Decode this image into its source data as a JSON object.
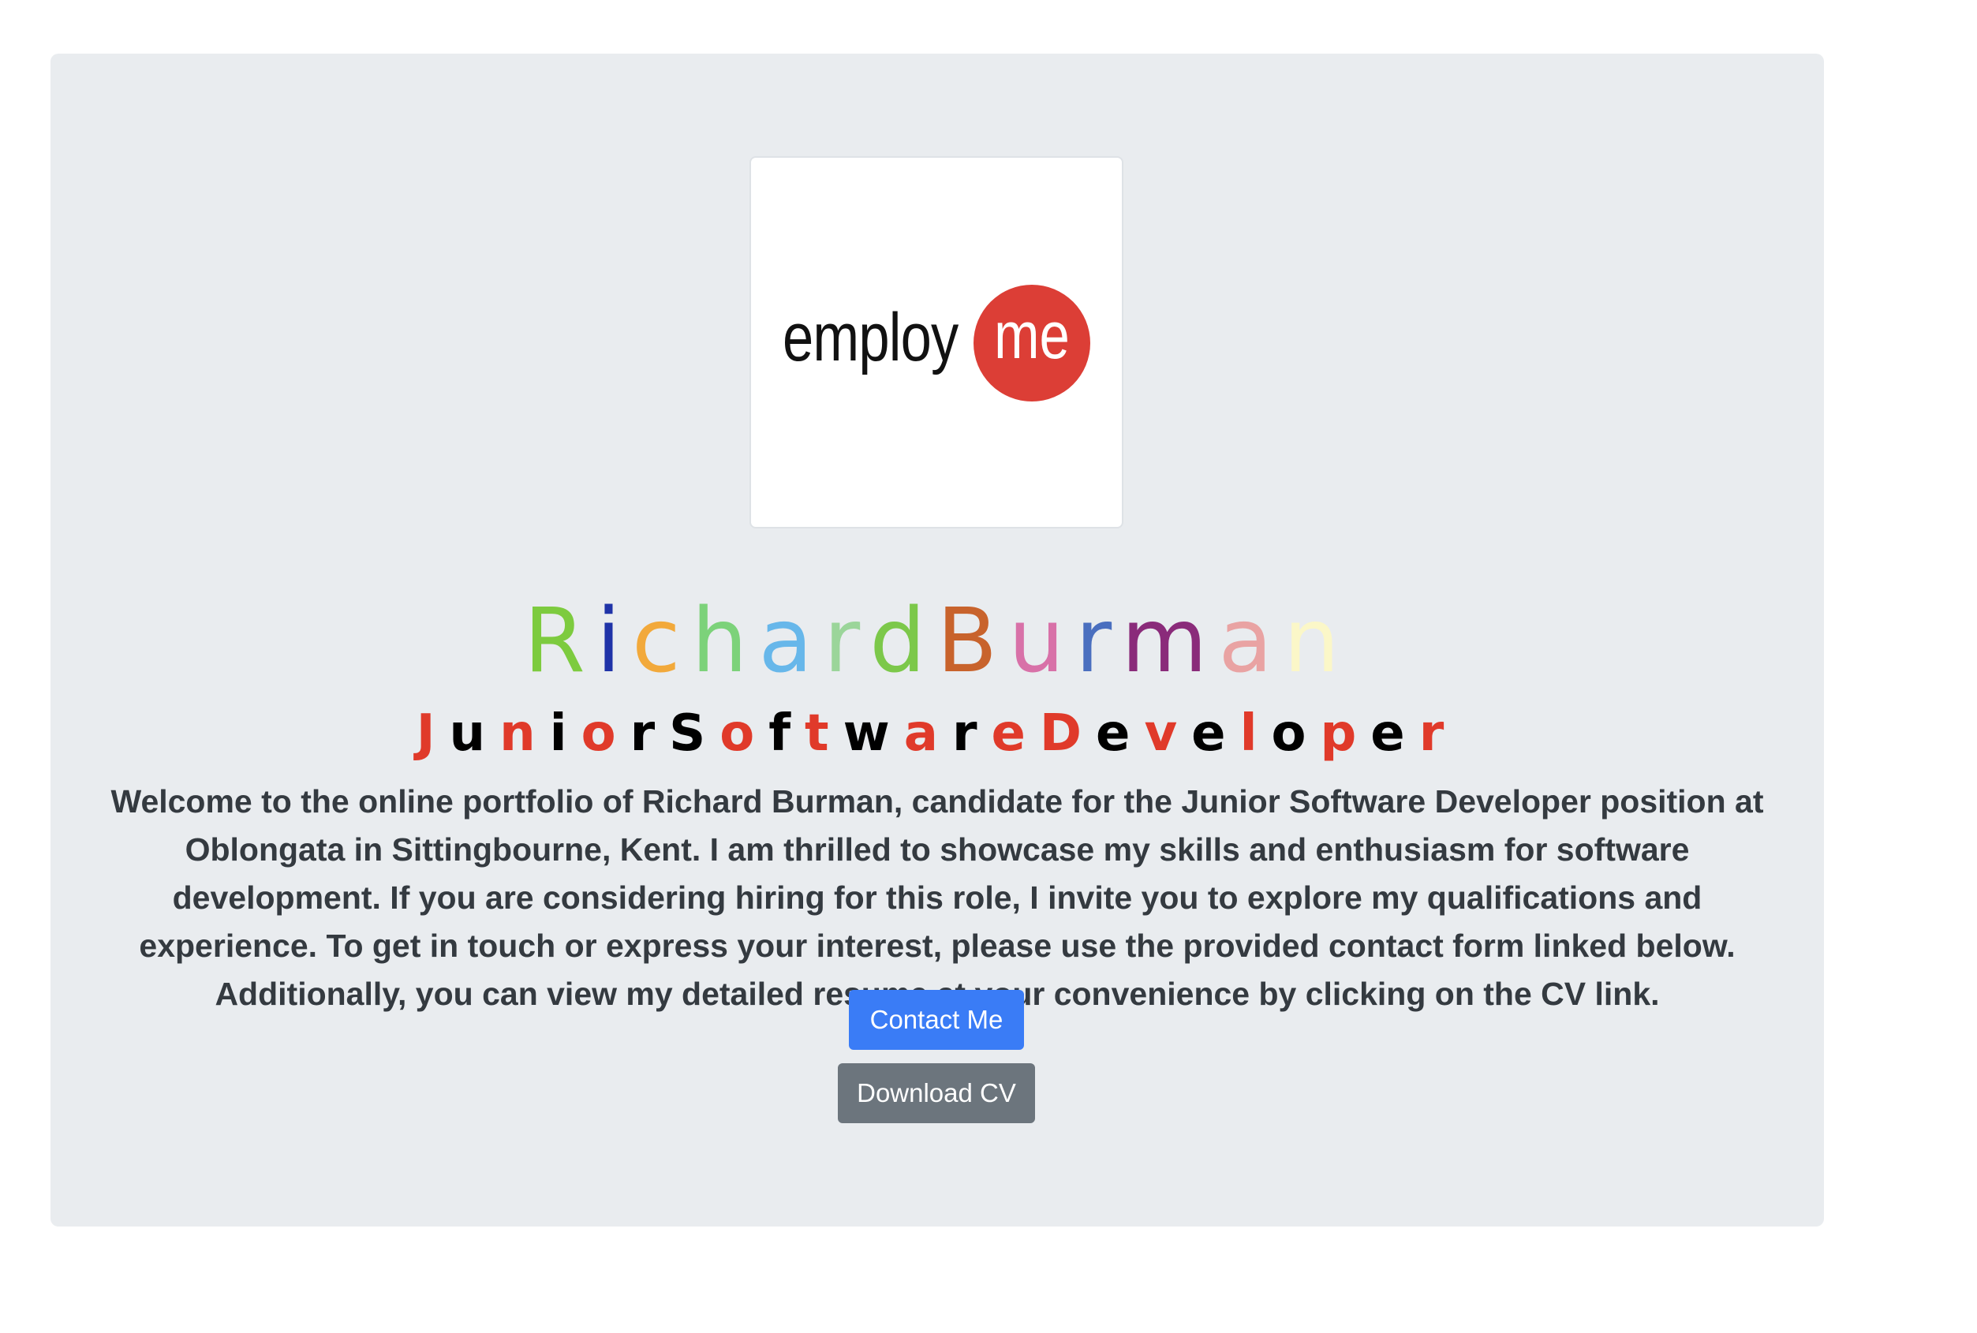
{
  "logo": {
    "left_text": "employ",
    "circle_text": "me",
    "circle_color": "#dc3e36"
  },
  "name": {
    "text": "RichardBurman",
    "letter_colors": [
      "#7dcb3f",
      "#1f33a8",
      "#f2a93b",
      "#7cd27a",
      "#67b7ea",
      "#9bd59a",
      "#7cc84a",
      "#c8632c",
      "#d871a8",
      "#4a6fbf",
      "#8a2b7a",
      "#e9a3a3",
      "#fbf7c8"
    ]
  },
  "title": {
    "text": "JuniorSoftwareDeveloper",
    "letter_colors": [
      "#e03a2a",
      "#000000",
      "#e03a2a",
      "#000000",
      "#e03a2a",
      "#000000",
      "#000000",
      "#e03a2a",
      "#000000",
      "#e03a2a",
      "#000000",
      "#e03a2a",
      "#000000",
      "#e03a2a",
      "#e03a2a",
      "#000000",
      "#e03a2a",
      "#000000",
      "#e03a2a",
      "#000000",
      "#e03a2a",
      "#000000",
      "#e03a2a"
    ]
  },
  "intro": {
    "text": "Welcome to the online portfolio of Richard Burman, candidate for the Junior Software Developer position at Oblongata in Sittingbourne, Kent. I am thrilled to showcase my skills and enthusiasm for software development. If you are considering hiring for this role, I invite you to explore my qualifications and experience. To get in touch or express your interest, please use the provided contact form linked below. Additionally, you can view my detailed resume at your convenience by clicking on the CV link."
  },
  "buttons": {
    "contact_label": "Contact Me",
    "download_label": "Download CV",
    "primary_color": "#3a7cf6",
    "secondary_color": "#6c757d"
  }
}
